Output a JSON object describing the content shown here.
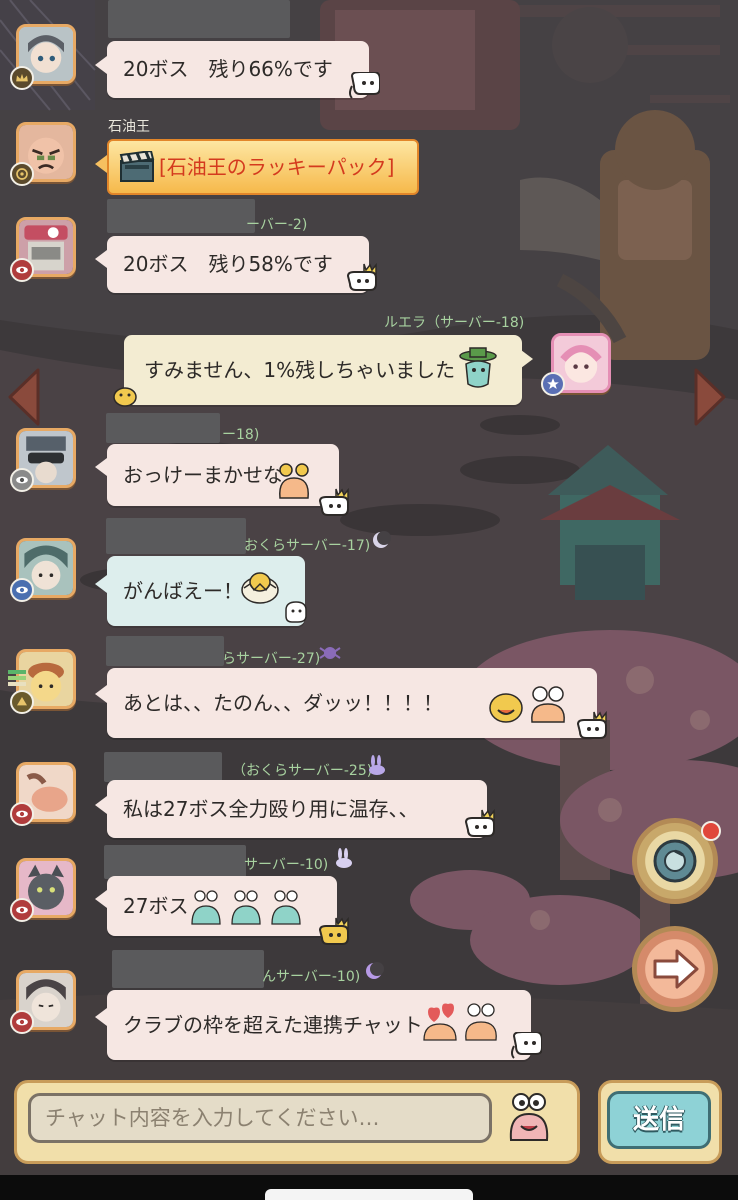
{
  "colors": {
    "bubble_pink": "#f6e7e3",
    "bubble_blue": "#ddeeed",
    "bubble_cream": "#f3ecd2",
    "server_text_green": "#a8d2a0",
    "avatar_border": "#e7a964",
    "send_button": "#8ed2d6"
  },
  "messages": [
    {
      "name": "",
      "text": "20ボス　残り66%です",
      "sticker": "ghost-bubble-icon",
      "badge": "crown-badge-icon"
    },
    {
      "name": "石油王",
      "text": "[石油王のラッキーパック]",
      "type": "lucky-pack",
      "badge": "snail-badge-icon"
    },
    {
      "name": "ーバー-2)",
      "text": "20ボス　残り58%です",
      "sticker": "ghost-crown-icon",
      "badge": "eye-badge-icon"
    },
    {
      "name": "ルエラ（サーバー-18)",
      "text": "すみません、1%残しちゃいました",
      "sticker": "green-hat-sticker-icon",
      "badge": "star-badge-icon",
      "own": true
    },
    {
      "name": "ー18)",
      "text": "おっけーまかせな",
      "sticker": "snail-sticker-icon",
      "badge": "eye-badge-icon"
    },
    {
      "name": "おくらサーバー-17)",
      "text": "がんばえー！",
      "sticker": "chick-egg-sticker-icon",
      "badge": "eye-badge-icon"
    },
    {
      "name": "らサーバー-27)",
      "text": "あとは、、たのん、、ダッッ！！！！",
      "sticker": "duck-snail-sticker-icon",
      "badge": "pudding-badge-icon"
    },
    {
      "name": "（おくらサーバー-25)",
      "text": "私は27ボス全力殴り用に温存、、",
      "sticker": "ghost-crown-icon",
      "badge": "eye-badge-icon"
    },
    {
      "name": "サーバー-10)",
      "text": "27ボス",
      "sticker": "snail-row-sticker-icon",
      "badge": "eye-badge-icon"
    },
    {
      "name": "んサーバー-10)",
      "text": "クラブの枠を超えた連携チャット",
      "sticker": "heart-snail-sticker-icon",
      "badge": "eye-badge-icon"
    }
  ],
  "input": {
    "placeholder": "チャット内容を入力してください…"
  },
  "send_label": "送信",
  "side_buttons": {
    "top_icon": "record-icon",
    "bottom_icon": "arrow-right-icon"
  },
  "nav": {
    "left_icon": "arrow-left-icon",
    "right_icon": "arrow-right-small-icon"
  }
}
